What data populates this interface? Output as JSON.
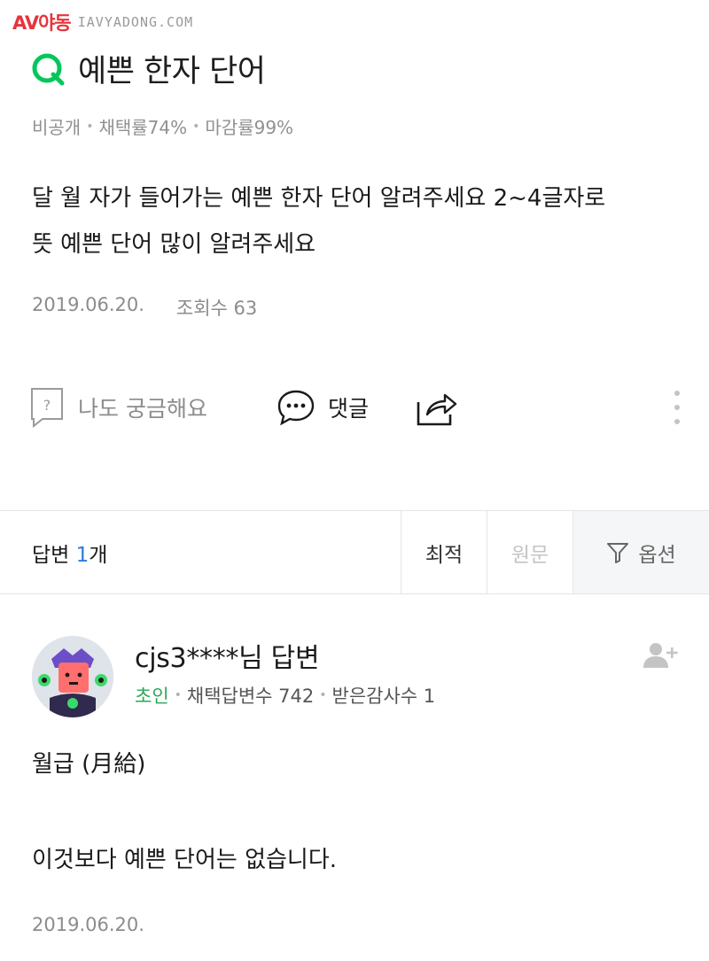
{
  "watermark": {
    "logo": "AV야동",
    "url": "IAVYADONG.COM"
  },
  "question": {
    "icon": "q-icon",
    "title": "예쁜 한자 단어",
    "meta": {
      "visibility": "비공개",
      "adoption_rate": "채택률74%",
      "closing_rate": "마감률99%"
    },
    "body_line1": "달 월 자가 들어가는 예쁜 한자 단어 알려주세요 2~4글자로",
    "body_line2": "뜻 예쁜 단어 많이 알려주세요",
    "date": "2019.06.20.",
    "views": "조회수 63"
  },
  "actions": {
    "curious_label": "나도 궁금해요",
    "comment_label": "댓글",
    "share_icon": "share-icon",
    "more_icon": "more-vertical-icon"
  },
  "answers_bar": {
    "label_prefix": "답변",
    "count": "1",
    "label_suffix": "개",
    "sort_best": "최적",
    "sort_original": "원문",
    "options": "옵션"
  },
  "answer": {
    "author": "cjs3****님 답변",
    "level": "초인",
    "adopted_count": "채택답변수 742",
    "thanks_count": "받은감사수 1",
    "line1": "월급 (月給)",
    "line2": "이것보다 예쁜 단어는 없습니다.",
    "date": "2019.06.20."
  },
  "colors": {
    "brand_green": "#03c75a",
    "level_green": "#2aa85a",
    "count_blue": "#2d7bd8",
    "watermark_red": "#e8333b"
  }
}
